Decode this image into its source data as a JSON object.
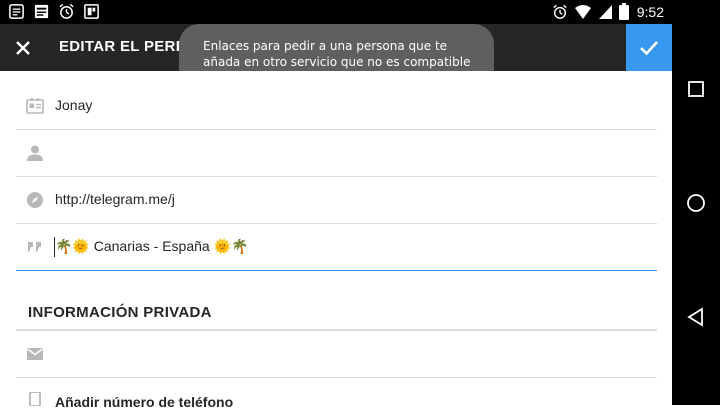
{
  "status_bar": {
    "time": "9:52",
    "left_icons": [
      "notes-icon",
      "document-icon",
      "alarm-icon",
      "gallery-icon"
    ],
    "right_icons": [
      "alarm-icon",
      "wifi-icon",
      "signal-icon",
      "battery-icon"
    ]
  },
  "toolbar": {
    "title": "EDITAR EL PERFIL",
    "close_icon": "close-icon",
    "confirm_icon": "check-icon",
    "accent_color": "#3897f0"
  },
  "toast": {
    "text": "Enlaces para pedir a una persona que te añada en otro servicio que no es compatible con Instagram."
  },
  "form": {
    "fields": [
      {
        "icon": "id-card-icon",
        "value": "Jonay"
      },
      {
        "icon": "person-icon",
        "value": ""
      },
      {
        "icon": "compass-icon",
        "value": "http://telegram.me/j"
      },
      {
        "icon": "quote-icon",
        "value": "🌴🌞 Canarias - España 🌞🌴"
      }
    ],
    "private_section": {
      "title": "INFORMACIÓN PRIVADA",
      "email_icon": "mail-icon",
      "email_value": "",
      "phone_icon": "phone-icon",
      "phone_label": "Añadir número de teléfono"
    }
  },
  "nav_bar": [
    "recents-button",
    "home-button",
    "back-button"
  ]
}
